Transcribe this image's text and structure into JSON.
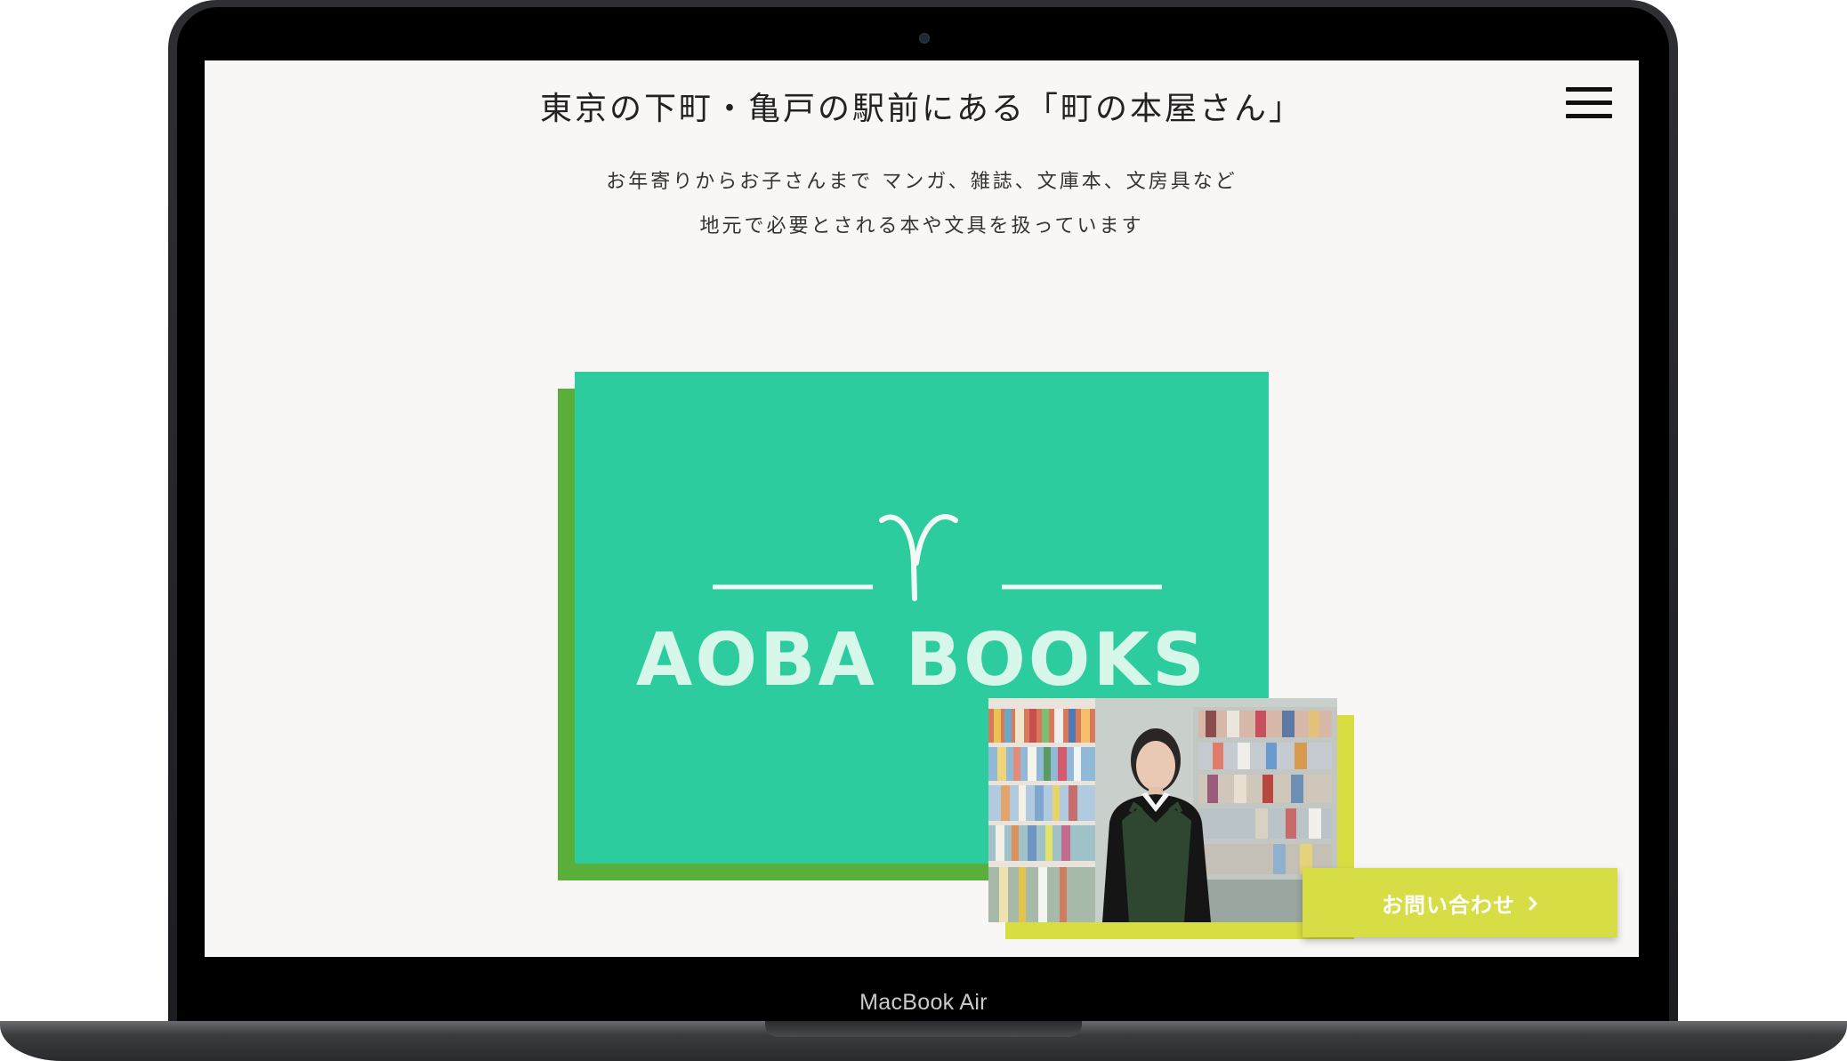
{
  "device": {
    "label": "MacBook Air"
  },
  "header": {
    "headline": "東京の下町・亀戸の駅前にある「町の本屋さん」",
    "menu_icon": "hamburger-menu-icon"
  },
  "intro": {
    "line1": "お年寄りからお子さんまで マンガ、雑誌、文庫本、文房具など",
    "line2": "地元で必要とされる本や文具を扱っています"
  },
  "hero": {
    "logo_text": "AOBA BOOKS",
    "logo_mark": "sprout-icon",
    "background": "#2ccc9f",
    "shadow_color": "#5aae3a",
    "logo_color": "#d7f7ea"
  },
  "photo": {
    "subject": "bookstore-staff-photo",
    "accent": "#d8dd42"
  },
  "contact": {
    "label": "お問い合わせ",
    "icon": "chevron-right-icon",
    "background": "#d6dd45"
  }
}
